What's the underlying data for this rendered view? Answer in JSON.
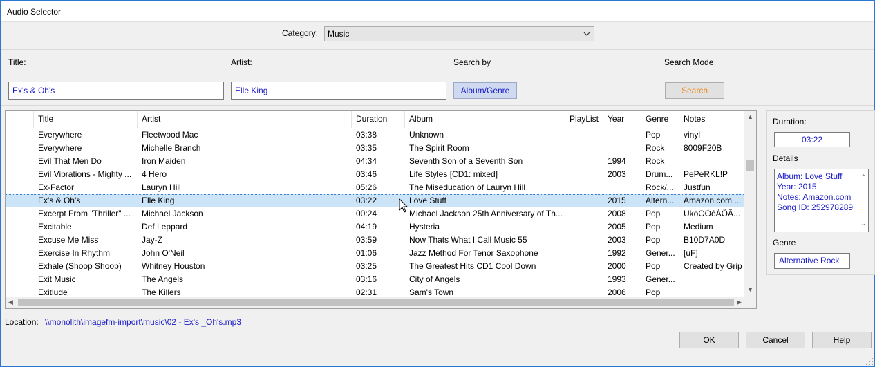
{
  "window": {
    "title": "Audio Selector"
  },
  "category": {
    "label": "Category:",
    "value": "Music"
  },
  "search": {
    "title_label": "Title:",
    "artist_label": "Artist:",
    "search_by_label": "Search by",
    "search_mode_label": "Search Mode",
    "title_value": "Ex's & Oh's",
    "artist_value": "Elle King",
    "search_by_button": "Album/Genre",
    "search_mode_button": "Search"
  },
  "table": {
    "columns": [
      "Title",
      "Artist",
      "Duration",
      "Album",
      "PlayList",
      "Year",
      "Genre",
      "Notes"
    ],
    "rows": [
      [
        "Everywhere",
        "Fleetwood Mac",
        "03:38",
        "Unknown",
        "",
        "",
        "Pop",
        "vinyl"
      ],
      [
        "Everywhere",
        "Michelle Branch",
        "03:35",
        "The Spirit Room",
        "",
        "",
        "Rock",
        "8009F20B"
      ],
      [
        "Evil That Men Do",
        "Iron Maiden",
        "04:34",
        "Seventh Son of a Seventh Son",
        "",
        "1994",
        "Rock",
        ""
      ],
      [
        "Evil Vibrations - Mighty ...",
        "4 Hero",
        "03:46",
        "Life Styles [CD1: mixed]",
        "",
        "2003",
        "Drum...",
        "PePeRKL!P"
      ],
      [
        "Ex-Factor",
        "Lauryn Hill",
        "05:26",
        "The Miseducation of Lauryn Hill",
        "",
        "",
        "Rock/...",
        "Justfun"
      ],
      [
        "Ex's & Oh's",
        "Elle King",
        "03:22",
        "Love Stuff",
        "",
        "2015",
        "Altern...",
        "Amazon.com ..."
      ],
      [
        "Excerpt From \"Thriller\" ...",
        "Michael Jackson",
        "00:24",
        "Michael Jackson 25th Anniversary of Th...",
        "",
        "2008",
        "Pop",
        "UkoOÒôÀÔÂ..."
      ],
      [
        "Excitable",
        "Def Leppard",
        "04:19",
        "Hysteria",
        "",
        "2005",
        "Pop",
        "Medium"
      ],
      [
        "Excuse Me Miss",
        "Jay-Z",
        "03:59",
        "Now Thats What I Call Music 55",
        "",
        "2003",
        "Pop",
        "B10D7A0D"
      ],
      [
        "Exercise In Rhythm",
        "John O'Neil",
        "01:06",
        "Jazz Method For Tenor Saxophone",
        "",
        "1992",
        "Gener...",
        "[uF]"
      ],
      [
        "Exhale (Shoop Shoop)",
        "Whitney Houston",
        "03:25",
        "The Greatest Hits CD1 Cool Down",
        "",
        "2000",
        "Pop",
        "Created by Grip"
      ],
      [
        "Exit Music",
        "The Angels",
        "03:16",
        "City of Angels",
        "",
        "1993",
        "Gener...",
        ""
      ],
      [
        "Exitlude",
        "The Killers",
        "02:31",
        "Sam's Town",
        "",
        "2006",
        "Pop",
        ""
      ]
    ],
    "selected_index": 5
  },
  "side_panel": {
    "duration_label": "Duration:",
    "duration_value": "03:22",
    "details_label": "Details",
    "details_lines": [
      "Album: Love Stuff",
      "Year: 2015",
      "Notes: Amazon.com",
      "Song ID: 252978289"
    ],
    "genre_label": "Genre",
    "genre_value": "Alternative Rock"
  },
  "location": {
    "label": "Location:",
    "path": "\\\\monolith\\imagefm-import\\music\\02 - Ex's _Oh's.mp3"
  },
  "buttons": {
    "ok": "OK",
    "cancel": "Cancel",
    "help": "Help"
  }
}
